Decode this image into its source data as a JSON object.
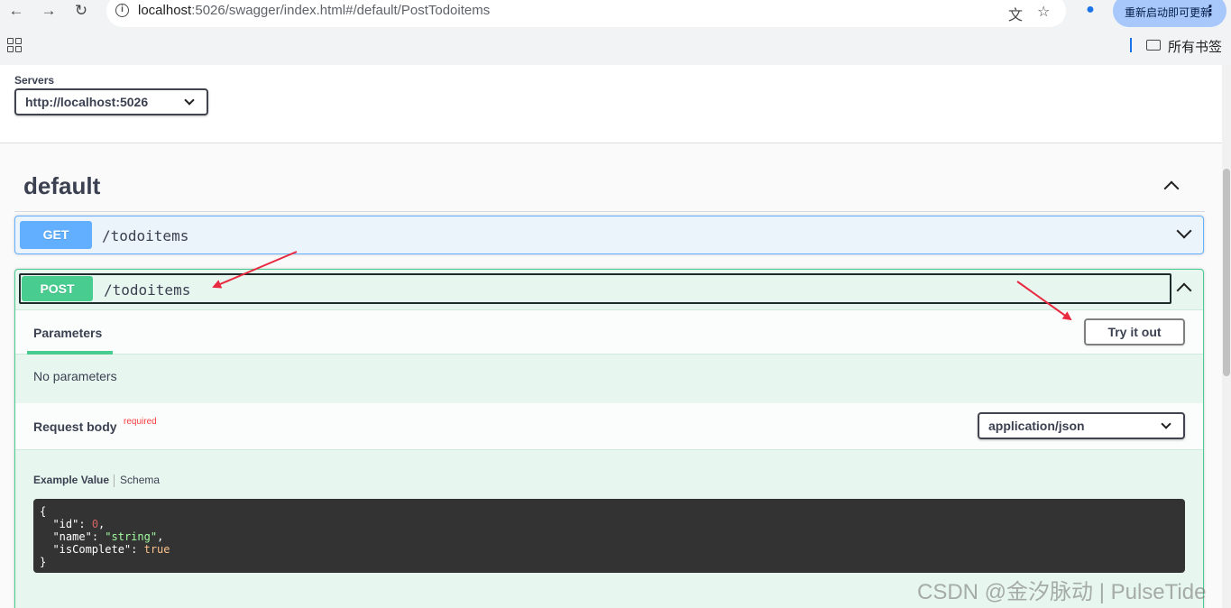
{
  "browser": {
    "url_host": "localhost",
    "url_rest": ":5026/swagger/index.html#/default/PostTodoitems",
    "update_button": "重新启动即可更新",
    "bookmarks_label": "所有书签",
    "icons": [
      "back-icon",
      "forward-icon",
      "reload-icon",
      "info-icon",
      "translate-icon",
      "star-icon",
      "profile-icon",
      "menu-icon",
      "apps-icon",
      "folder-icon"
    ]
  },
  "servers": {
    "title": "Servers",
    "selected": "http://localhost:5026"
  },
  "tag": {
    "name": "default"
  },
  "operations": {
    "get": {
      "method": "GET",
      "path": "/todoitems",
      "color": "#61affe"
    },
    "post": {
      "method": "POST",
      "path": "/todoitems",
      "color": "#49cc90",
      "parameters_tab": "Parameters",
      "try_it_out": "Try it out",
      "no_parameters": "No parameters",
      "request_body_title": "Request body",
      "required_label": "required",
      "content_type": "application/json",
      "example_tab": "Example Value",
      "schema_tab": "Schema",
      "example": {
        "open": "{",
        "close": "}",
        "lines": [
          {
            "key": "\"id\"",
            "value": "0",
            "suffix": ","
          },
          {
            "key": "\"name\"",
            "value": "\"string\"",
            "suffix": ","
          },
          {
            "key": "\"isComplete\"",
            "value": "true",
            "suffix": ""
          }
        ]
      }
    }
  },
  "watermark": "CSDN @金汐脉动 | PulseTide"
}
